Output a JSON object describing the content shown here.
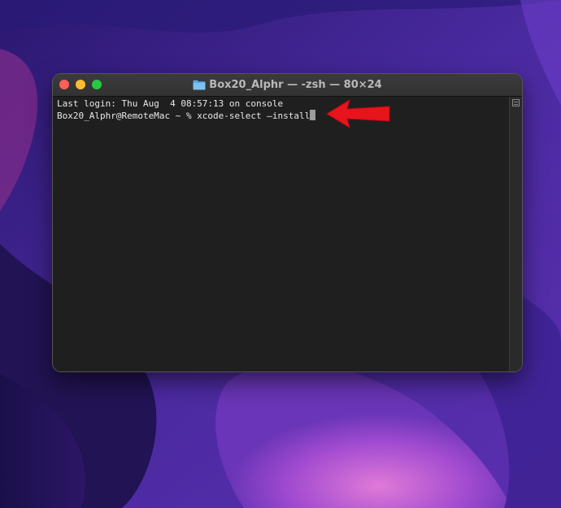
{
  "window": {
    "title": "Box20_Alphr — -zsh — 80×24",
    "title_icon": "folder-icon"
  },
  "terminal": {
    "last_login": "Last login: Thu Aug  4 08:57:13 on console",
    "prompt": "Box20_Alphr@RemoteMac ~ % ",
    "command": "xcode-select —install"
  },
  "annotation": {
    "arrow_icon": "red-arrow-icon",
    "arrow_color": "#e8141b"
  },
  "colors": {
    "traffic_close": "#ff5f57",
    "traffic_minimize": "#febc2e",
    "traffic_zoom": "#28c840",
    "terminal_bg": "#1f1f1f",
    "terminal_text": "#e8e8e8"
  }
}
